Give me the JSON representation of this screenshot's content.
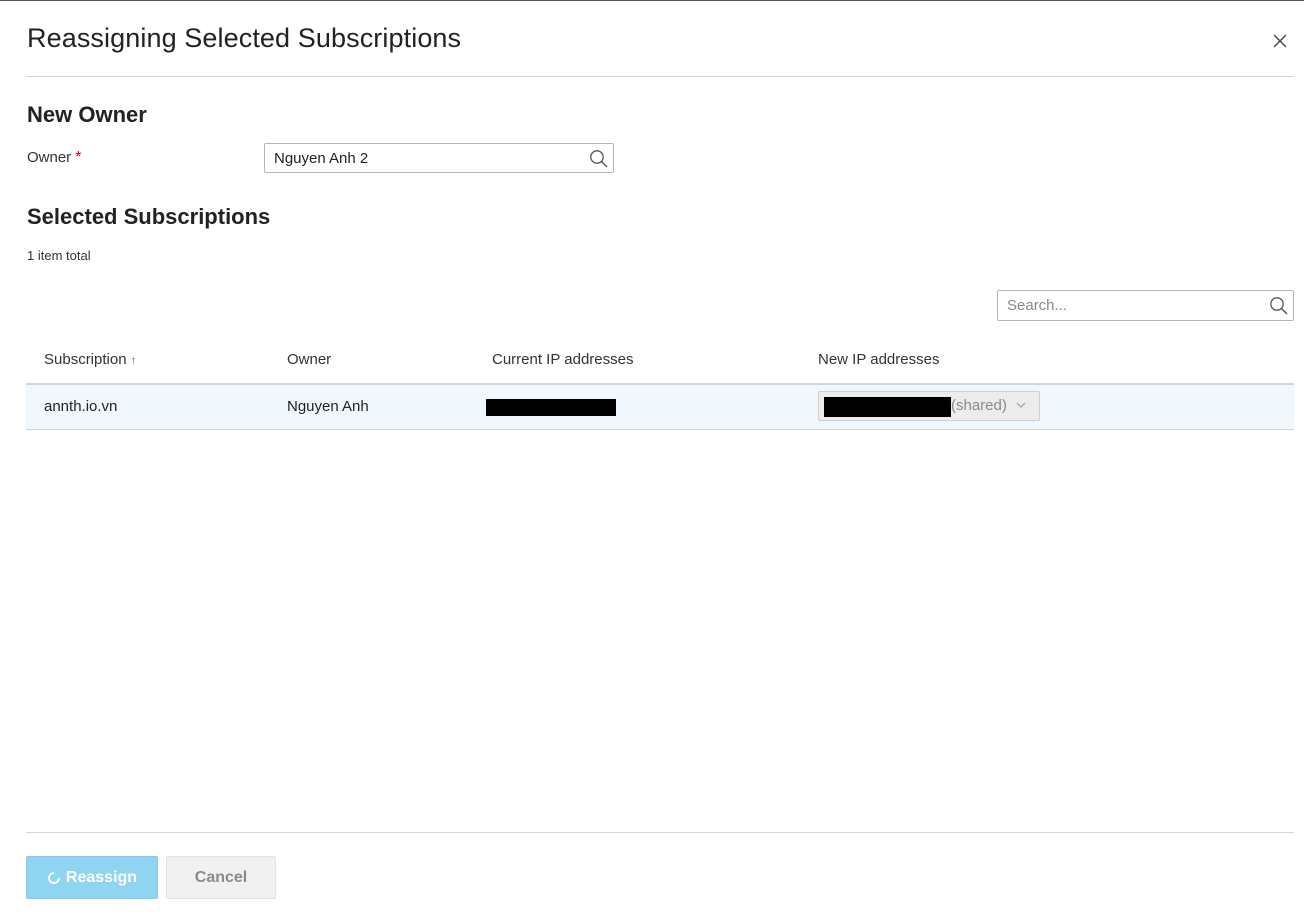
{
  "dialog": {
    "title": "Reassigning Selected Subscriptions"
  },
  "new_owner": {
    "heading": "New Owner",
    "owner_label": "Owner",
    "required_mark": "*",
    "owner_value": "Nguyen Anh 2"
  },
  "selected": {
    "heading": "Selected Subscriptions",
    "total": "1 item total",
    "search_placeholder": "Search..."
  },
  "table": {
    "columns": {
      "subscription": "Subscription",
      "sort_indicator": "↑",
      "owner": "Owner",
      "current_ip": "Current IP addresses",
      "new_ip": "New IP addresses"
    },
    "rows": [
      {
        "subscription": "annth.io.vn",
        "owner": "Nguyen Anh",
        "new_ip_suffix": "(shared)"
      }
    ]
  },
  "footer": {
    "reassign_label": "Reassign",
    "cancel_label": "Cancel"
  },
  "colors": {
    "accent_button": "#8fd4f1",
    "required": "#d0021b",
    "row_highlight": "#f0f7fd"
  },
  "icons": [
    "close-icon",
    "search-icon",
    "sort-up-icon",
    "chevron-down-icon",
    "spinner-icon"
  ]
}
